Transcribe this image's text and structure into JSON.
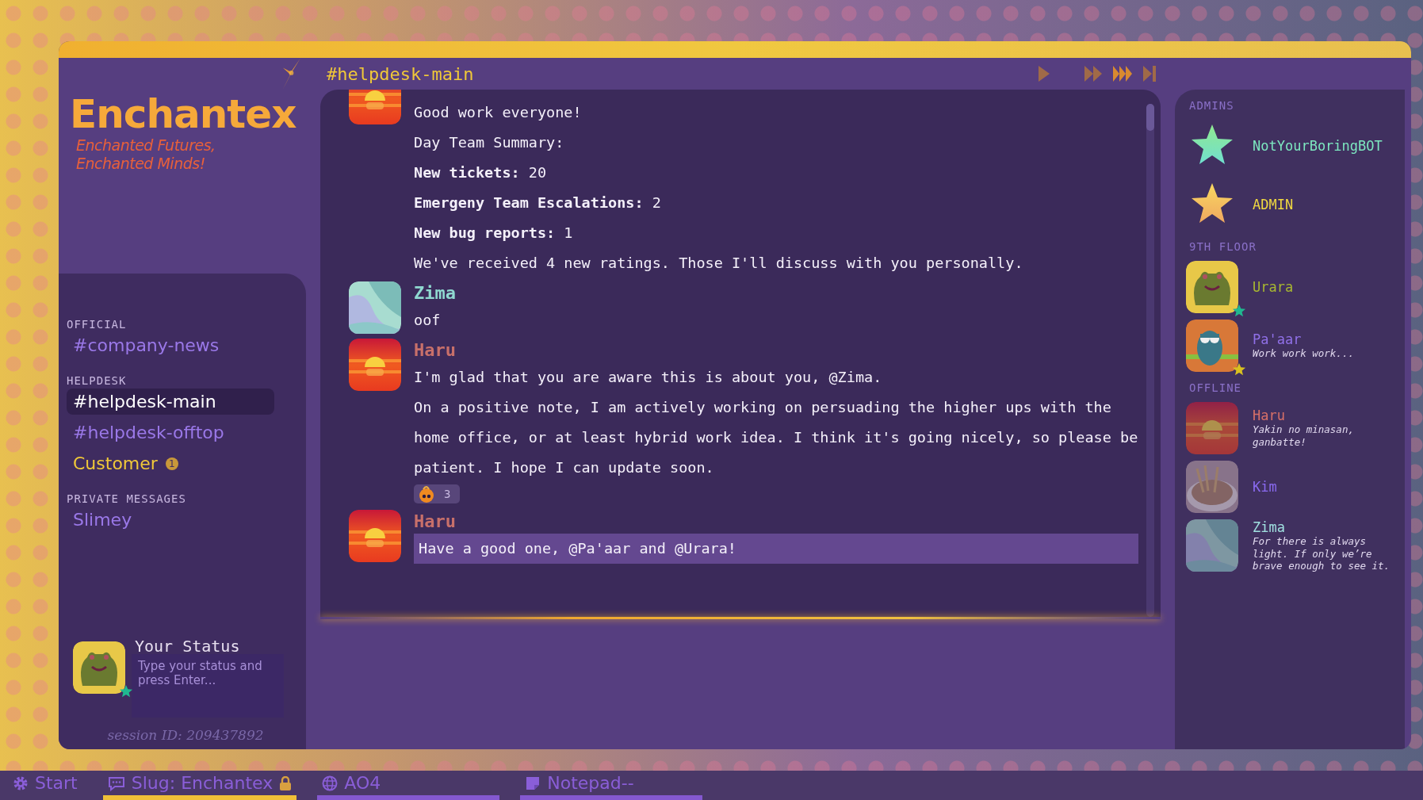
{
  "logo": {
    "name": "Enchantex",
    "tagline_1": "Enchanted Futures,",
    "tagline_2": "Enchanted Minds!"
  },
  "channel_groups": [
    {
      "heading": "OFFICIAL",
      "items": [
        {
          "label": "#company-news",
          "selected": false,
          "kind": "channel"
        }
      ]
    },
    {
      "heading": "HELPDESK",
      "items": [
        {
          "label": "#helpdesk-main",
          "selected": true,
          "kind": "channel"
        },
        {
          "label": "#helpdesk-offtop",
          "selected": false,
          "kind": "channel"
        },
        {
          "label": "Customer",
          "selected": false,
          "kind": "customer",
          "badge": "1"
        }
      ]
    },
    {
      "heading": "PRIVATE MESSAGES",
      "items": [
        {
          "label": "Slimey",
          "selected": false,
          "kind": "channel"
        }
      ]
    }
  ],
  "status": {
    "title": "Your Status",
    "placeholder": "Type your status and press Enter...",
    "session": "session ID: 209437892"
  },
  "channel_title": "#helpdesk-main",
  "messages": [
    {
      "kind": "sunset",
      "highlighted": false,
      "lines": [
        "Good work everyone!",
        "Day Team Summary:",
        "**New tickets:** 20",
        "**Emergeny Team Escalations:** 2",
        "**New bug reports:** 1",
        "We've received 4 new ratings. Those I'll discuss with you personally."
      ]
    },
    {
      "author": "Zima",
      "kind": "waves",
      "highlighted": false,
      "lines": [
        "oof"
      ]
    },
    {
      "author": "Haru",
      "kind": "sunset",
      "highlighted": false,
      "lines": [
        "I'm glad that you are aware this is about you, @Zima.",
        "On a positive note, I am actively working on persuading the higher ups with the home office, or at least hybrid work idea. I think it's going nicely, so please be patient. I hope I can update soon."
      ],
      "reaction": {
        "count": "3"
      }
    },
    {
      "author": "Haru",
      "kind": "sunset",
      "highlighted": true,
      "lines": [
        "Have a good one, @Pa'aar and @Urara!"
      ]
    }
  ],
  "member_groups": [
    {
      "heading": "ADMINS",
      "members": [
        {
          "name": "NotYourBoringBOT",
          "kind": "star-mint",
          "color": "#7de8c0",
          "online": true
        },
        {
          "name": "ADMIN",
          "kind": "star-gold",
          "color": "#f0d840",
          "online": true
        }
      ]
    },
    {
      "heading": "9TH FLOOR",
      "members": [
        {
          "name": "Urara",
          "kind": "frog",
          "color": "#a8b830",
          "online": true
        },
        {
          "name": "Pa'aar",
          "kind": "owl",
          "color": "#9070e8",
          "online": true,
          "status": "Work work work..."
        }
      ]
    },
    {
      "heading": "OFFLINE",
      "members": [
        {
          "name": "Haru",
          "kind": "sunset",
          "color": "#d87068",
          "online": false,
          "status": "Yakin no minasan, ganbatte!"
        },
        {
          "name": "Kim",
          "kind": "noodles",
          "color": "#8a6af0",
          "online": false
        },
        {
          "name": "Zima",
          "kind": "waves",
          "color": "#a0e0e0",
          "online": false,
          "status": "For there is always light. If only we’re brave enough to see it."
        }
      ]
    }
  ],
  "taskbar": [
    {
      "label": "Start",
      "open": false,
      "selected": false,
      "locked": false
    },
    {
      "label": "Slug: Enchantex",
      "open": true,
      "selected": true,
      "locked": true
    },
    {
      "label": "AO4",
      "open": true,
      "selected": false,
      "locked": false
    },
    {
      "label": "Notepad--",
      "open": true,
      "selected": false,
      "locked": false
    }
  ]
}
